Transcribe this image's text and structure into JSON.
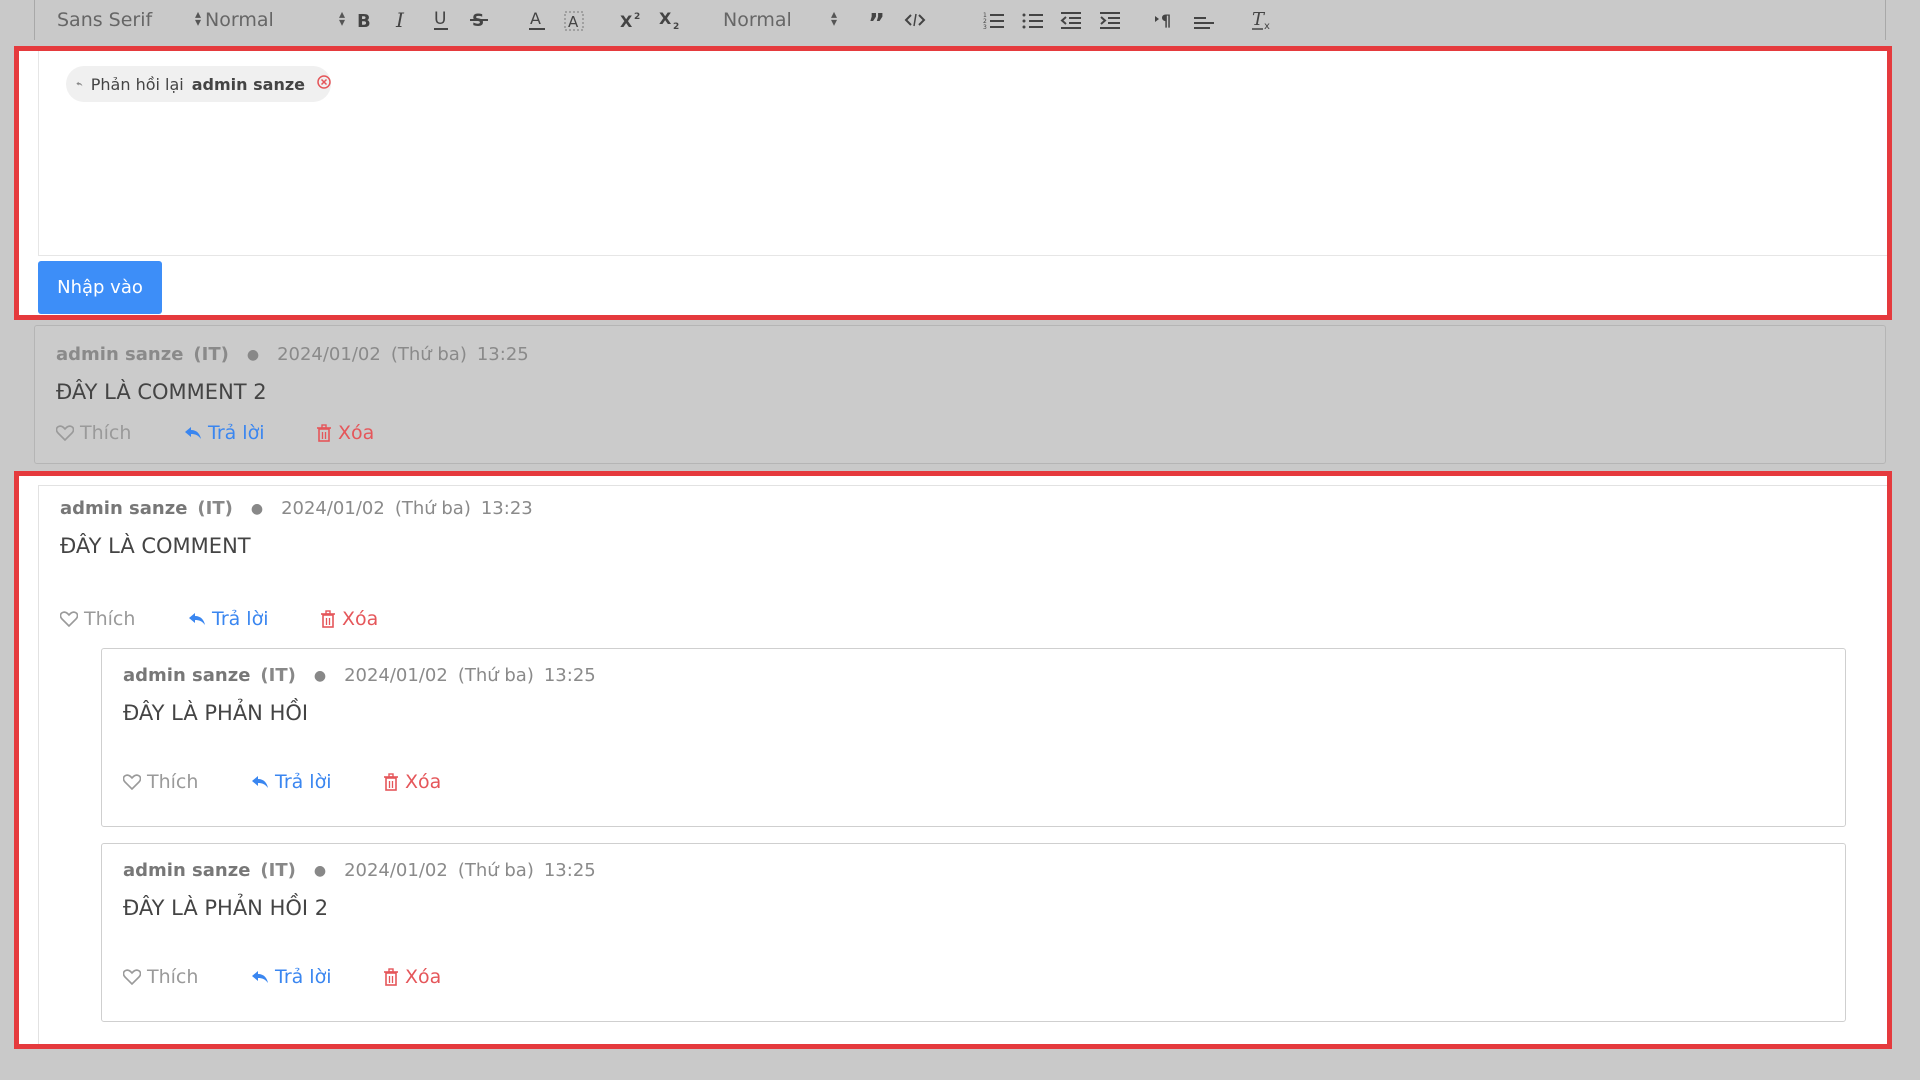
{
  "toolbar": {
    "font_family": "Sans Serif",
    "font_size": "Normal",
    "header": "Normal",
    "icons": [
      "bold-icon",
      "italic-icon",
      "underline-icon",
      "strike-icon",
      "font-color-icon",
      "background-color-icon",
      "superscript-icon",
      "subscript-icon",
      "blockquote-icon",
      "code-block-icon",
      "ordered-list-icon",
      "bullet-list-icon",
      "outdent-icon",
      "indent-icon",
      "text-direction-icon",
      "align-icon",
      "clear-format-icon"
    ]
  },
  "editor": {
    "reply_prefix": "Phản hồi lại",
    "reply_to": "admin sanze",
    "submit_label": "Nhập vào"
  },
  "actions": {
    "like": "Thích",
    "reply": "Trả lời",
    "delete": "Xóa"
  },
  "comments": [
    {
      "author": "admin sanze",
      "dept": "(IT)",
      "date": "2024/01/02",
      "weekday": "(Thứ ba)",
      "time": "13:25",
      "text": "ĐÂY LÀ COMMENT 2"
    },
    {
      "author": "admin sanze",
      "dept": "(IT)",
      "date": "2024/01/02",
      "weekday": "(Thứ ba)",
      "time": "13:23",
      "text": "ĐÂY LÀ COMMENT",
      "replies": [
        {
          "author": "admin sanze",
          "dept": "(IT)",
          "date": "2024/01/02",
          "weekday": "(Thứ ba)",
          "time": "13:25",
          "text": "ĐÂY LÀ PHẢN HỒI"
        },
        {
          "author": "admin sanze",
          "dept": "(IT)",
          "date": "2024/01/02",
          "weekday": "(Thứ ba)",
          "time": "13:25",
          "text": "ĐÂY LÀ PHẢN HỒI 2"
        }
      ]
    }
  ],
  "colors": {
    "highlight_border": "#e53a3d",
    "primary_button": "#3d8ef8",
    "reply_link": "#3a86f0",
    "delete_link": "#e5565a",
    "overlay_gray": "#c9c9c9"
  }
}
